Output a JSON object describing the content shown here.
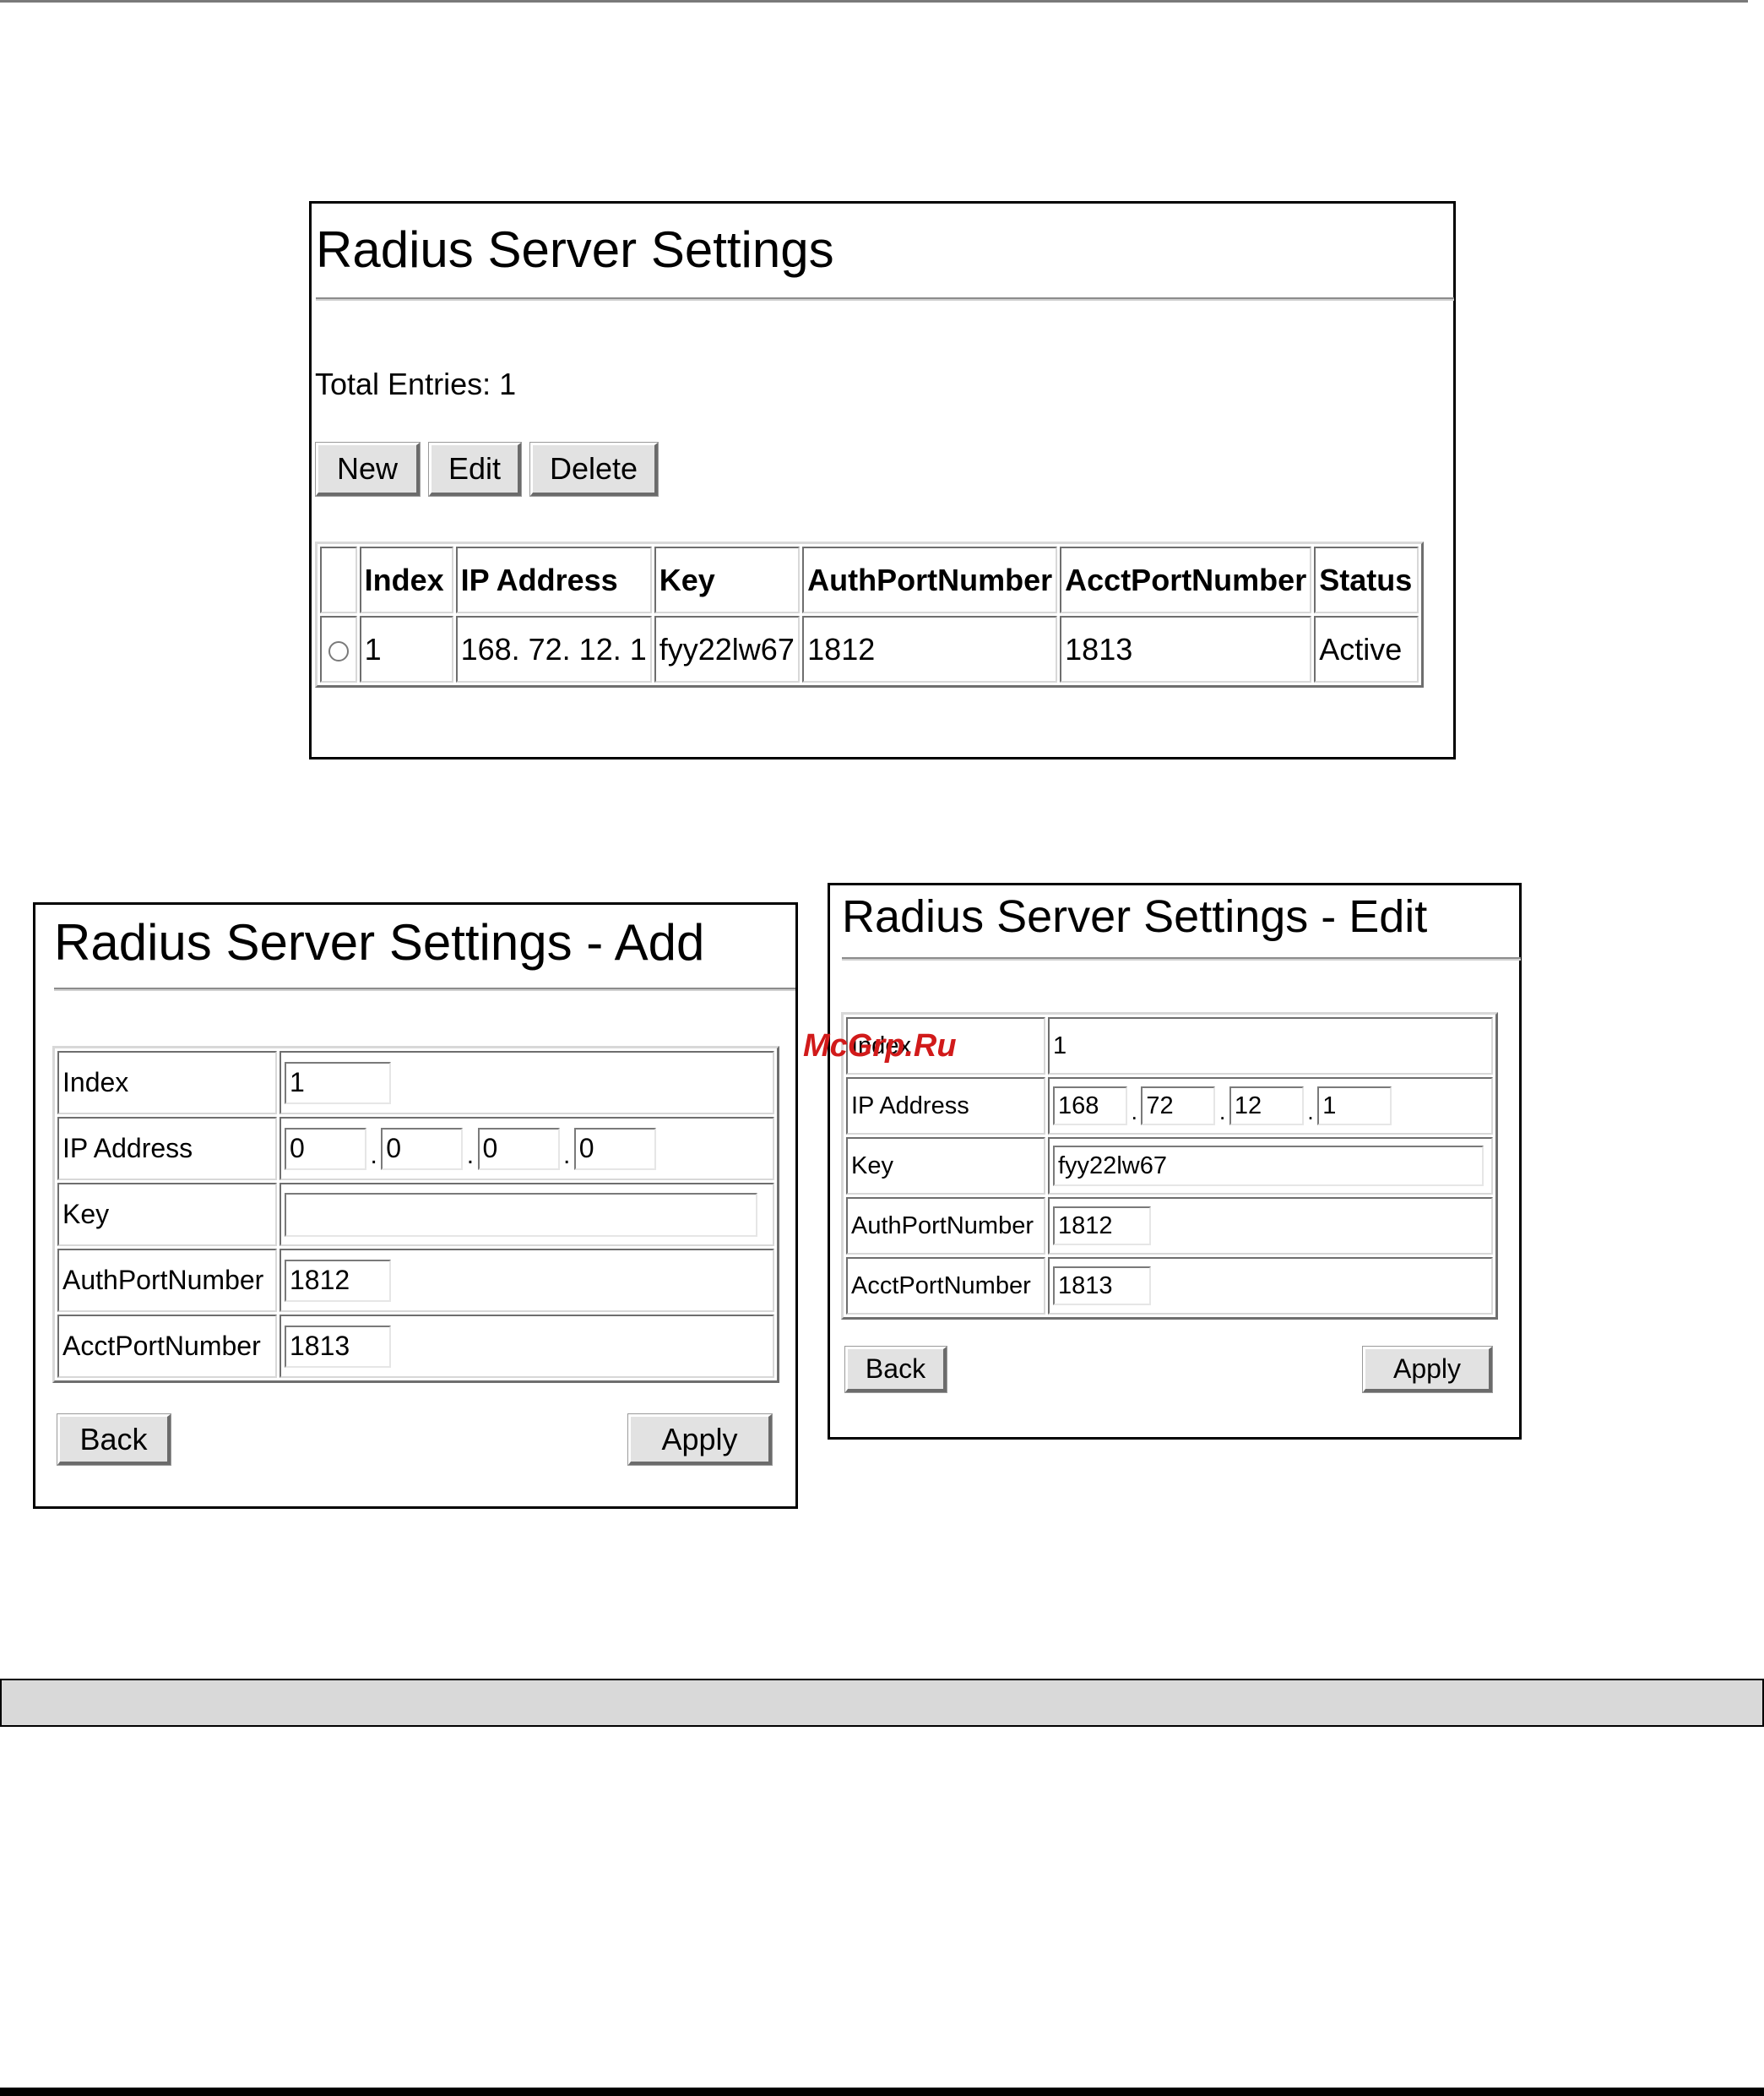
{
  "main": {
    "title": "Radius Server Settings",
    "total_entries": "Total Entries: 1",
    "buttons": {
      "new": "New",
      "edit": "Edit",
      "delete": "Delete"
    },
    "table": {
      "headers": [
        "",
        "Index",
        "IP Address",
        "Key",
        "AuthPortNumber",
        "AcctPortNumber",
        "Status"
      ],
      "rows": [
        {
          "index": "1",
          "ip": "168. 72. 12. 1",
          "key": "fyy22lw67",
          "auth": "1812",
          "acct": "1813",
          "status": "Active"
        }
      ]
    }
  },
  "add": {
    "title": "Radius Server Settings - Add",
    "labels": {
      "index": "Index",
      "ip": "IP Address",
      "key": "Key",
      "auth": "AuthPortNumber",
      "acct": "AcctPortNumber"
    },
    "values": {
      "index": "1",
      "ip1": "0",
      "ip2": "0",
      "ip3": "0",
      "ip4": "0",
      "key": "",
      "auth": "1812",
      "acct": "1813"
    },
    "back": "Back",
    "apply": "Apply"
  },
  "edit": {
    "title": "Radius Server Settings - Edit",
    "labels": {
      "index": "Index",
      "ip": "IP Address",
      "key": "Key",
      "auth": "AuthPortNumber",
      "acct": "AcctPortNumber"
    },
    "values": {
      "index": "1",
      "ip1": "168",
      "ip2": "72",
      "ip3": "12",
      "ip4": "1",
      "key": "fyy22lw67",
      "auth": "1812",
      "acct": "1813"
    },
    "back": "Back",
    "apply": "Apply"
  },
  "ip_separator": ".",
  "watermark": "McGrp.Ru",
  "colors": {
    "watermark": "#d11a1a",
    "button_face": "#e2e2e2",
    "bar_gray": "#d9d9d9"
  }
}
